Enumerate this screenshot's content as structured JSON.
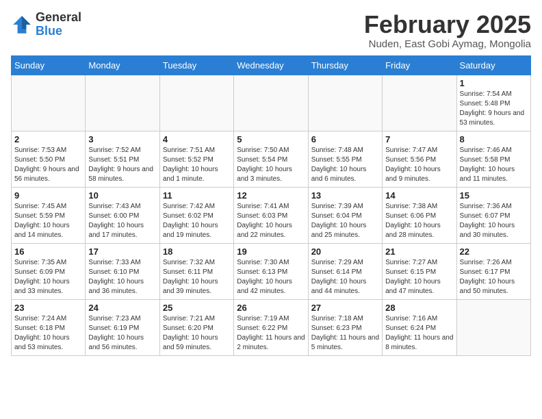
{
  "header": {
    "logo_general": "General",
    "logo_blue": "Blue",
    "month_title": "February 2025",
    "subtitle": "Nuden, East Gobi Aymag, Mongolia"
  },
  "days_of_week": [
    "Sunday",
    "Monday",
    "Tuesday",
    "Wednesday",
    "Thursday",
    "Friday",
    "Saturday"
  ],
  "weeks": [
    [
      {
        "day": "",
        "info": ""
      },
      {
        "day": "",
        "info": ""
      },
      {
        "day": "",
        "info": ""
      },
      {
        "day": "",
        "info": ""
      },
      {
        "day": "",
        "info": ""
      },
      {
        "day": "",
        "info": ""
      },
      {
        "day": "1",
        "info": "Sunrise: 7:54 AM\nSunset: 5:48 PM\nDaylight: 9 hours and 53 minutes."
      }
    ],
    [
      {
        "day": "2",
        "info": "Sunrise: 7:53 AM\nSunset: 5:50 PM\nDaylight: 9 hours and 56 minutes."
      },
      {
        "day": "3",
        "info": "Sunrise: 7:52 AM\nSunset: 5:51 PM\nDaylight: 9 hours and 58 minutes."
      },
      {
        "day": "4",
        "info": "Sunrise: 7:51 AM\nSunset: 5:52 PM\nDaylight: 10 hours and 1 minute."
      },
      {
        "day": "5",
        "info": "Sunrise: 7:50 AM\nSunset: 5:54 PM\nDaylight: 10 hours and 3 minutes."
      },
      {
        "day": "6",
        "info": "Sunrise: 7:48 AM\nSunset: 5:55 PM\nDaylight: 10 hours and 6 minutes."
      },
      {
        "day": "7",
        "info": "Sunrise: 7:47 AM\nSunset: 5:56 PM\nDaylight: 10 hours and 9 minutes."
      },
      {
        "day": "8",
        "info": "Sunrise: 7:46 AM\nSunset: 5:58 PM\nDaylight: 10 hours and 11 minutes."
      }
    ],
    [
      {
        "day": "9",
        "info": "Sunrise: 7:45 AM\nSunset: 5:59 PM\nDaylight: 10 hours and 14 minutes."
      },
      {
        "day": "10",
        "info": "Sunrise: 7:43 AM\nSunset: 6:00 PM\nDaylight: 10 hours and 17 minutes."
      },
      {
        "day": "11",
        "info": "Sunrise: 7:42 AM\nSunset: 6:02 PM\nDaylight: 10 hours and 19 minutes."
      },
      {
        "day": "12",
        "info": "Sunrise: 7:41 AM\nSunset: 6:03 PM\nDaylight: 10 hours and 22 minutes."
      },
      {
        "day": "13",
        "info": "Sunrise: 7:39 AM\nSunset: 6:04 PM\nDaylight: 10 hours and 25 minutes."
      },
      {
        "day": "14",
        "info": "Sunrise: 7:38 AM\nSunset: 6:06 PM\nDaylight: 10 hours and 28 minutes."
      },
      {
        "day": "15",
        "info": "Sunrise: 7:36 AM\nSunset: 6:07 PM\nDaylight: 10 hours and 30 minutes."
      }
    ],
    [
      {
        "day": "16",
        "info": "Sunrise: 7:35 AM\nSunset: 6:09 PM\nDaylight: 10 hours and 33 minutes."
      },
      {
        "day": "17",
        "info": "Sunrise: 7:33 AM\nSunset: 6:10 PM\nDaylight: 10 hours and 36 minutes."
      },
      {
        "day": "18",
        "info": "Sunrise: 7:32 AM\nSunset: 6:11 PM\nDaylight: 10 hours and 39 minutes."
      },
      {
        "day": "19",
        "info": "Sunrise: 7:30 AM\nSunset: 6:13 PM\nDaylight: 10 hours and 42 minutes."
      },
      {
        "day": "20",
        "info": "Sunrise: 7:29 AM\nSunset: 6:14 PM\nDaylight: 10 hours and 44 minutes."
      },
      {
        "day": "21",
        "info": "Sunrise: 7:27 AM\nSunset: 6:15 PM\nDaylight: 10 hours and 47 minutes."
      },
      {
        "day": "22",
        "info": "Sunrise: 7:26 AM\nSunset: 6:17 PM\nDaylight: 10 hours and 50 minutes."
      }
    ],
    [
      {
        "day": "23",
        "info": "Sunrise: 7:24 AM\nSunset: 6:18 PM\nDaylight: 10 hours and 53 minutes."
      },
      {
        "day": "24",
        "info": "Sunrise: 7:23 AM\nSunset: 6:19 PM\nDaylight: 10 hours and 56 minutes."
      },
      {
        "day": "25",
        "info": "Sunrise: 7:21 AM\nSunset: 6:20 PM\nDaylight: 10 hours and 59 minutes."
      },
      {
        "day": "26",
        "info": "Sunrise: 7:19 AM\nSunset: 6:22 PM\nDaylight: 11 hours and 2 minutes."
      },
      {
        "day": "27",
        "info": "Sunrise: 7:18 AM\nSunset: 6:23 PM\nDaylight: 11 hours and 5 minutes."
      },
      {
        "day": "28",
        "info": "Sunrise: 7:16 AM\nSunset: 6:24 PM\nDaylight: 11 hours and 8 minutes."
      },
      {
        "day": "",
        "info": ""
      }
    ]
  ]
}
